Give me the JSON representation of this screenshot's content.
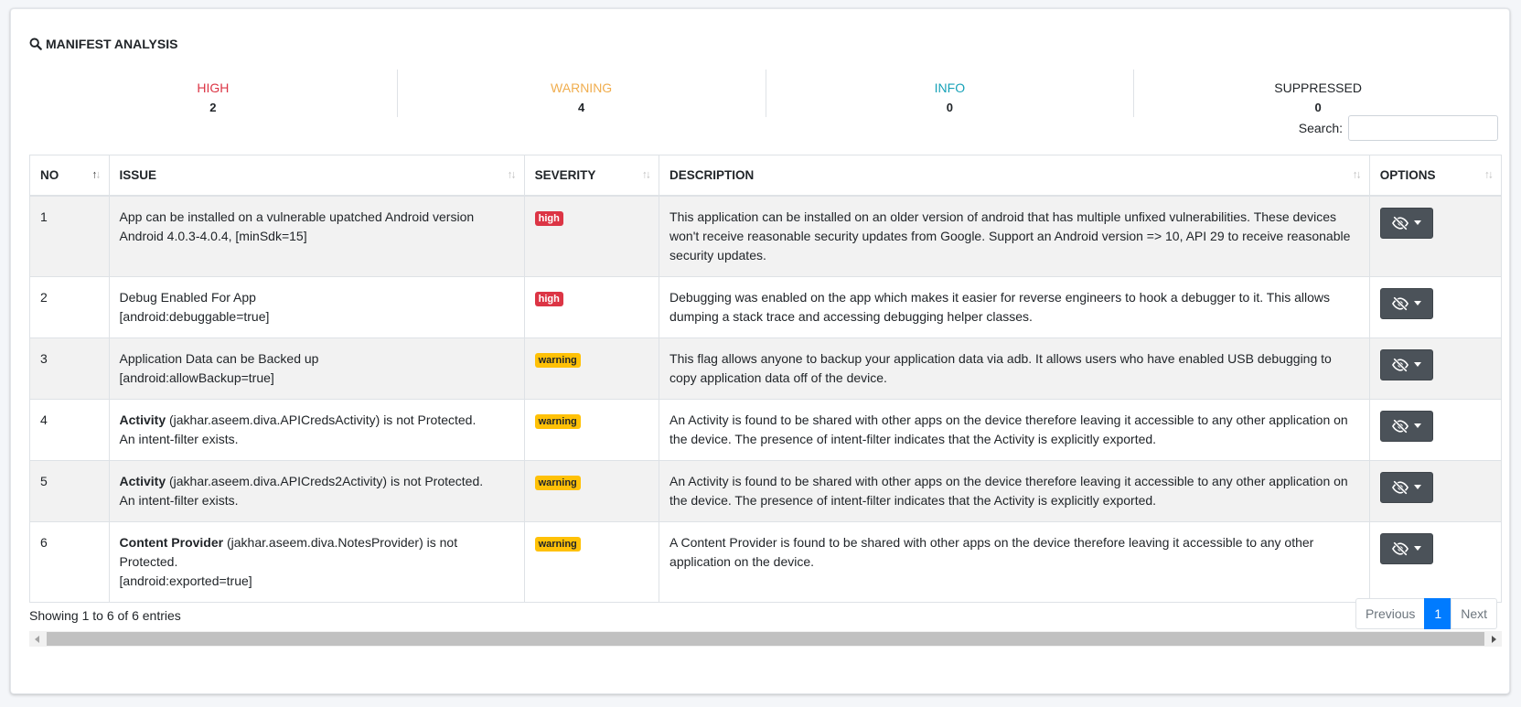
{
  "section": {
    "title": "MANIFEST ANALYSIS",
    "icon": "search-icon"
  },
  "stats": [
    {
      "key": "high",
      "label": "HIGH",
      "count": "2",
      "color": "#dc3545"
    },
    {
      "key": "warning",
      "label": "WARNING",
      "count": "4",
      "color": "#f0ad4e"
    },
    {
      "key": "info",
      "label": "INFO",
      "count": "0",
      "color": "#17a2b8"
    },
    {
      "key": "suppressed",
      "label": "SUPPRESSED",
      "count": "0",
      "color": "#212529"
    }
  ],
  "search": {
    "label": "Search:",
    "value": "",
    "placeholder": ""
  },
  "table": {
    "columns": [
      "NO",
      "ISSUE",
      "SEVERITY",
      "DESCRIPTION",
      "OPTIONS"
    ],
    "sorted_column": "NO",
    "sort_direction": "ascending",
    "rows": [
      {
        "no": "1",
        "issue_bold": "",
        "issue_text": "App can be installed on a vulnerable upatched Android version",
        "issue_detail": "Android 4.0.3-4.0.4, [minSdk=15]",
        "severity": "high",
        "description": "This application can be installed on an older version of android that has multiple unfixed vulnerabilities. These devices won't receive reasonable security updates from Google. Support an Android version => 10, API 29 to receive reasonable security updates."
      },
      {
        "no": "2",
        "issue_bold": "",
        "issue_text": "Debug Enabled For App",
        "issue_detail": "[android:debuggable=true]",
        "severity": "high",
        "description": "Debugging was enabled on the app which makes it easier for reverse engineers to hook a debugger to it. This allows dumping a stack trace and accessing debugging helper classes."
      },
      {
        "no": "3",
        "issue_bold": "",
        "issue_text": "Application Data can be Backed up",
        "issue_detail": "[android:allowBackup=true]",
        "severity": "warning",
        "description": "This flag allows anyone to backup your application data via adb. It allows users who have enabled USB debugging to copy application data off of the device."
      },
      {
        "no": "4",
        "issue_bold": "Activity",
        "issue_text": " (jakhar.aseem.diva.APICredsActivity) is not Protected.",
        "issue_detail": "An intent-filter exists.",
        "severity": "warning",
        "description": "An Activity is found to be shared with other apps on the device therefore leaving it accessible to any other application on the device. The presence of intent-filter indicates that the Activity is explicitly exported."
      },
      {
        "no": "5",
        "issue_bold": "Activity",
        "issue_text": " (jakhar.aseem.diva.APICreds2Activity) is not Protected.",
        "issue_detail": "An intent-filter exists.",
        "severity": "warning",
        "description": "An Activity is found to be shared with other apps on the device therefore leaving it accessible to any other application on the device. The presence of intent-filter indicates that the Activity is explicitly exported."
      },
      {
        "no": "6",
        "issue_bold": "Content Provider",
        "issue_text": " (jakhar.aseem.diva.NotesProvider) is not Protected.",
        "issue_detail": "[android:exported=true]",
        "severity": "warning",
        "description": "A Content Provider is found to be shared with other apps on the device therefore leaving it accessible to any other application on the device."
      }
    ],
    "option_icon": "eye-slash-icon"
  },
  "footer": {
    "info": "Showing 1 to 6 of 6 entries",
    "previous": "Previous",
    "current_page": "1",
    "next": "Next"
  }
}
